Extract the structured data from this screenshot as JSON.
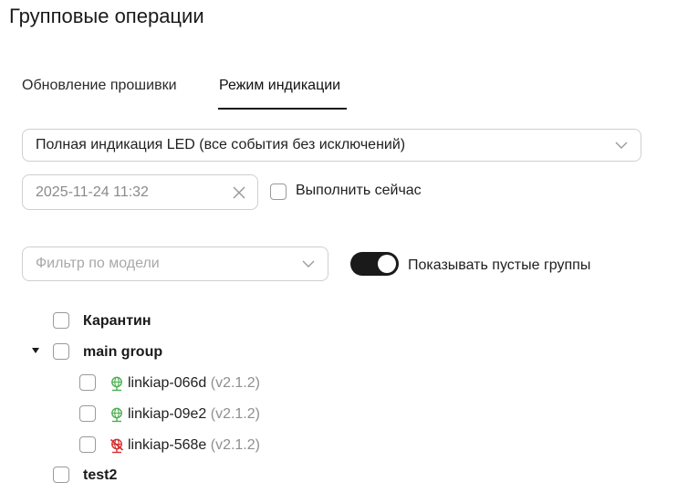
{
  "page": {
    "title": "Групповые операции"
  },
  "tabs": [
    {
      "label": "Обновление прошивки",
      "active": false
    },
    {
      "label": "Режим индикации",
      "active": true
    }
  ],
  "indication_select": {
    "value": "Полная индикация LED (все события без исключений)",
    "icon": "chevron-down-icon"
  },
  "datetime": {
    "value": "2025-11-24 11:32",
    "clear_icon": "close-icon"
  },
  "execute_now": {
    "label": "Выполнить сейчас",
    "checked": false
  },
  "model_filter": {
    "placeholder": "Фильтр по модели",
    "icon": "chevron-down-icon"
  },
  "show_empty": {
    "label": "Показывать пустые группы",
    "on": true
  },
  "tree": {
    "groups": [
      {
        "label": "Карантин",
        "checked": false
      },
      {
        "label": "main group",
        "checked": false,
        "expanded": true,
        "devices": [
          {
            "name": "linkiap-066d",
            "version": "(v2.1.2)",
            "status": "online",
            "icon": "globe-online-icon",
            "status_color": "#4caf50"
          },
          {
            "name": "linkiap-09e2",
            "version": "(v2.1.2)",
            "status": "online",
            "icon": "globe-online-icon",
            "status_color": "#4caf50"
          },
          {
            "name": "linkiap-568e",
            "version": "(v2.1.2)",
            "status": "offline",
            "icon": "globe-offline-icon",
            "status_color": "#d32f2f"
          }
        ]
      },
      {
        "label": "test2",
        "checked": false
      }
    ]
  },
  "colors": {
    "accent": "#1a1a1a",
    "border": "#cfcfcf",
    "online": "#4caf50",
    "offline": "#d32f2f"
  }
}
